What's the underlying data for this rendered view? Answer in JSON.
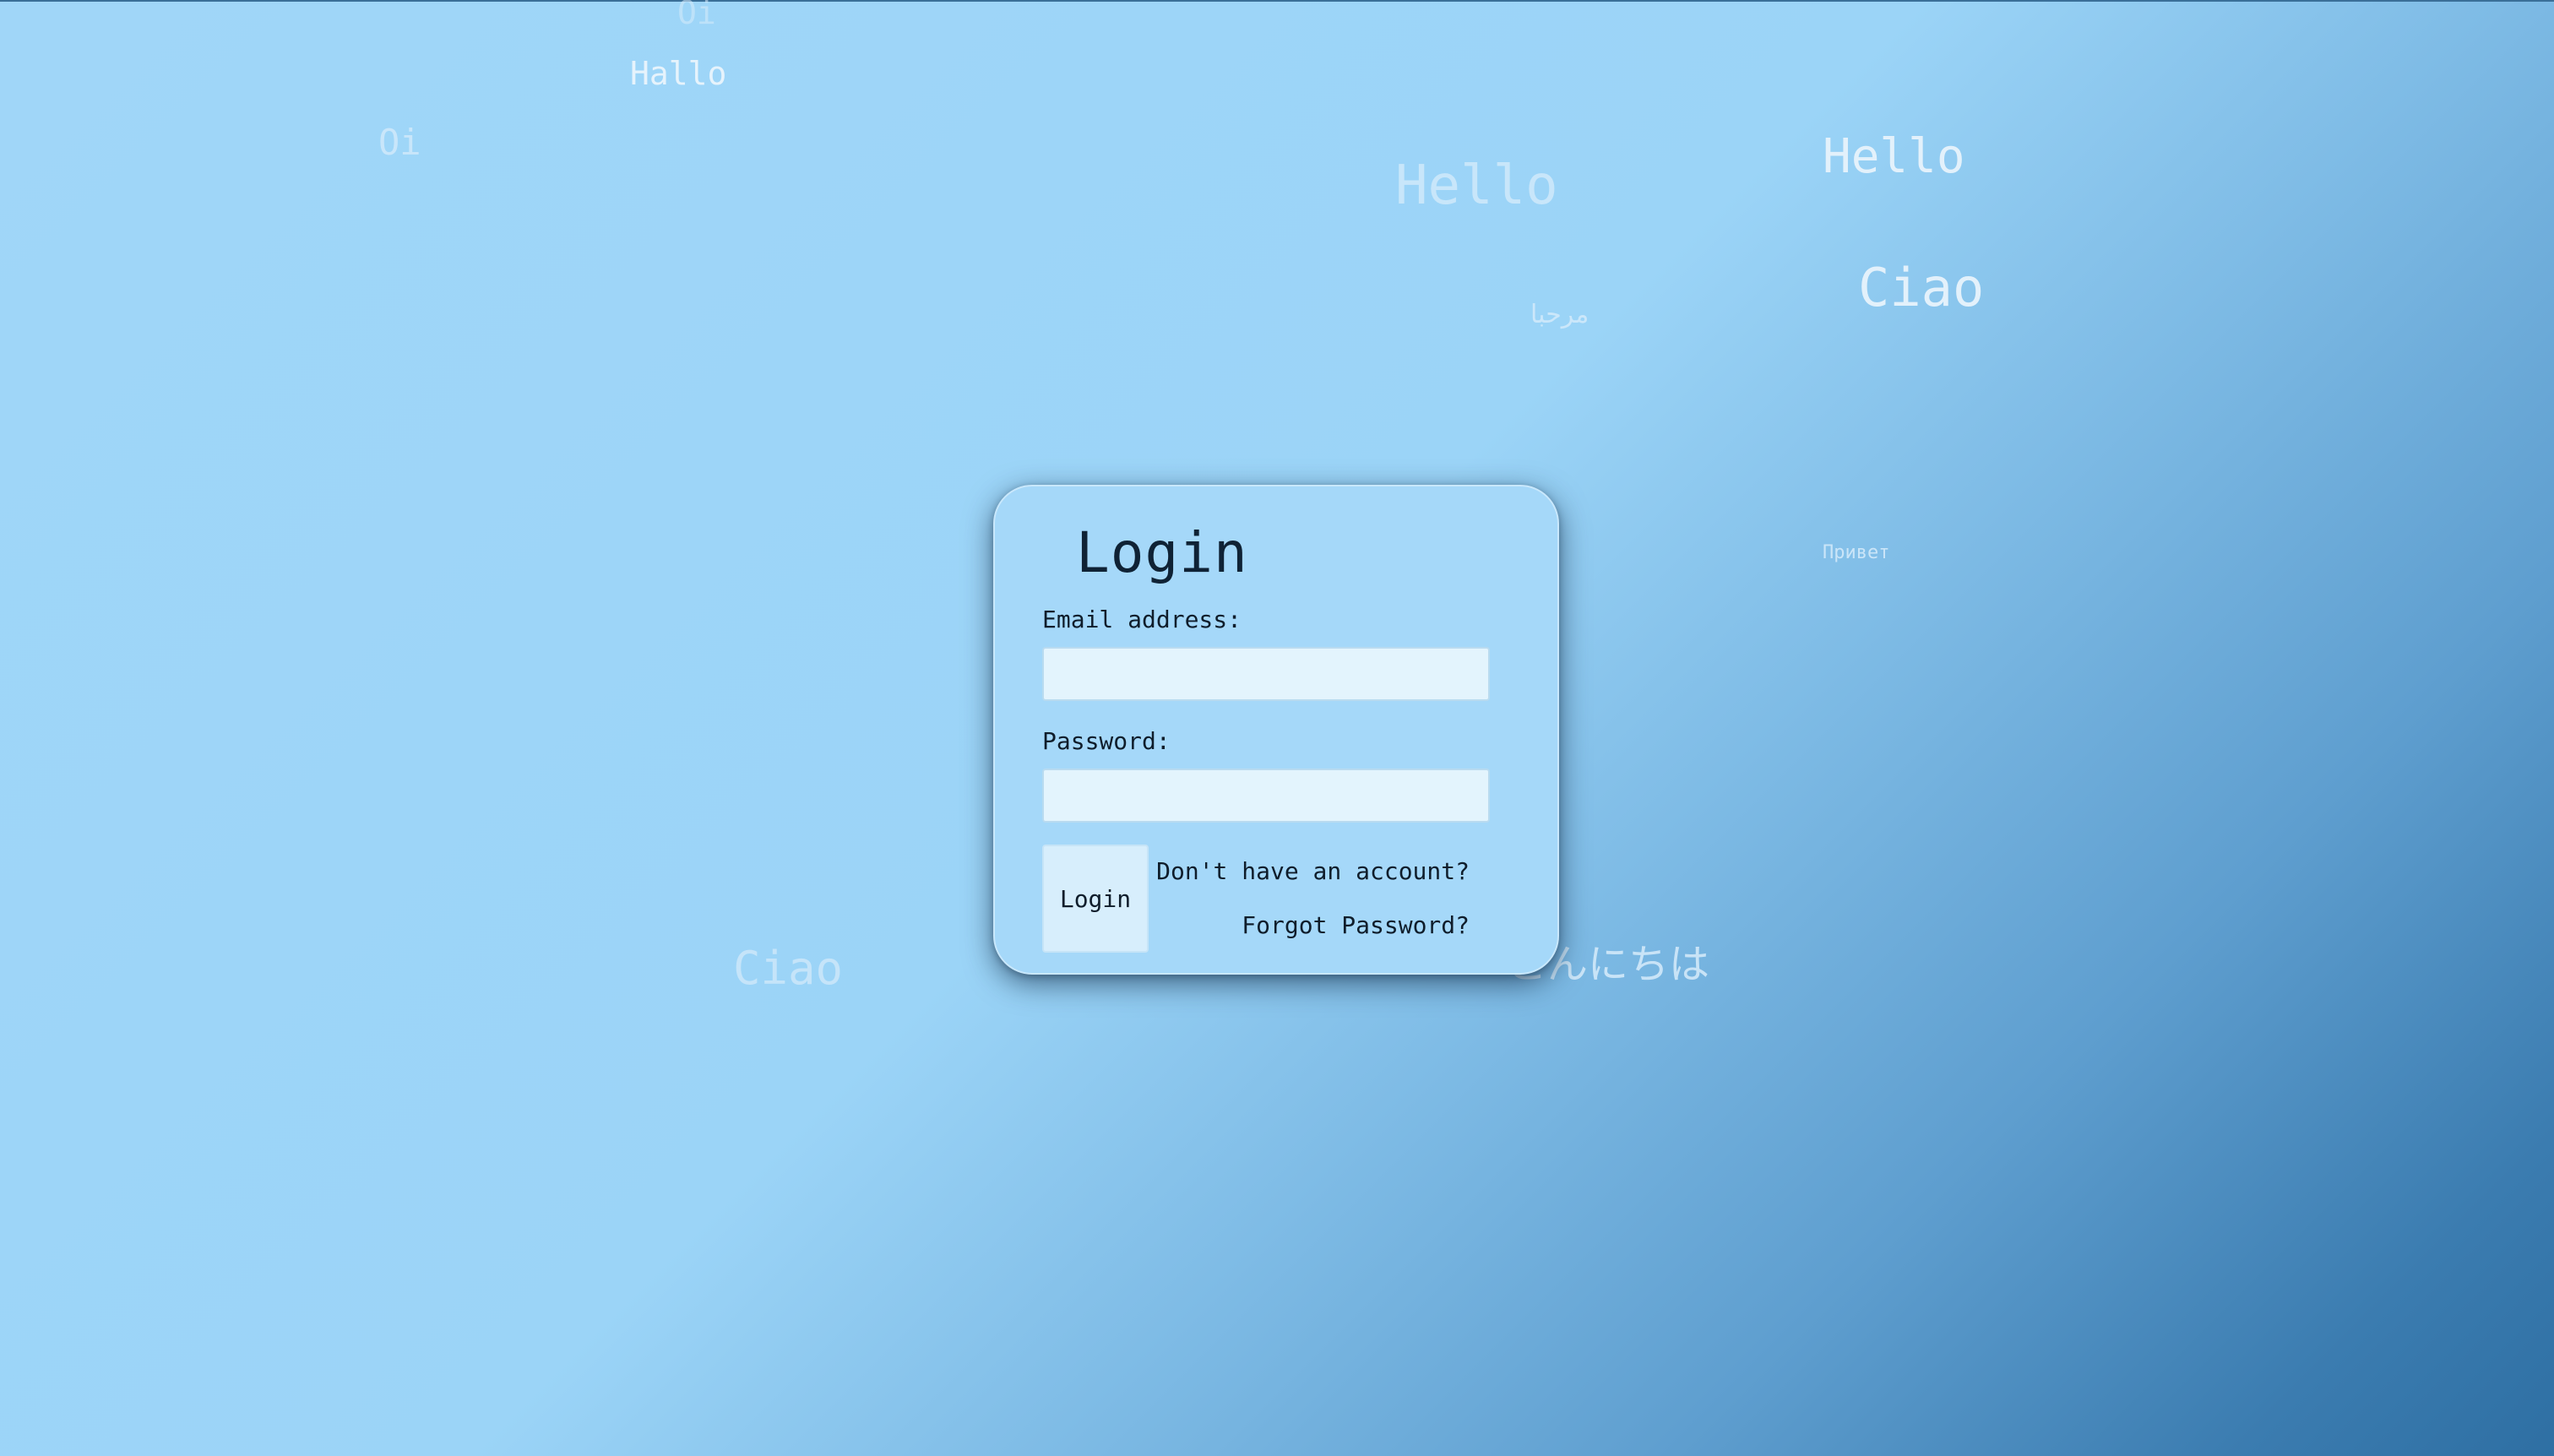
{
  "background_greetings": [
    {
      "text": "Oi"
    },
    {
      "text": "Hallo"
    },
    {
      "text": "Oi"
    },
    {
      "text": "Hello"
    },
    {
      "text": "Hello"
    },
    {
      "text": "Ciao"
    },
    {
      "text": "مرحبا"
    },
    {
      "text": "Привет"
    },
    {
      "text": "Ciao"
    },
    {
      "text": "こんにちは"
    }
  ],
  "login": {
    "title": "Login",
    "email_label": "Email address:",
    "email_value": "",
    "password_label": "Password:",
    "password_value": "",
    "submit_label": "Login",
    "signup_link": "Don't have an account?",
    "forgot_link": "Forgot Password?"
  },
  "colors": {
    "card_background": "#a5d8f9",
    "input_background": "#e3f4fd",
    "greeting_text": "#d7ecfb",
    "gradient_end": "#2e6fa3"
  }
}
